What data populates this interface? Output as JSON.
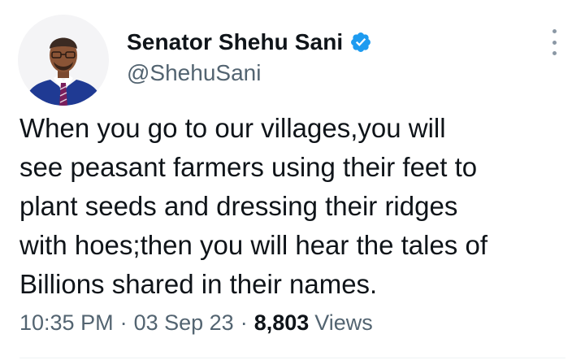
{
  "author": {
    "display_name": "Senator Shehu Sani",
    "handle": "@ShehuSani",
    "verified": true,
    "verified_color": "#1d9bf0"
  },
  "tweet": {
    "lines": [
      "When you go to our villages,you will",
      "see peasant farmers using their feet to",
      "plant seeds and dressing their ridges",
      "with hoes;then you will hear the tales of",
      "Billions shared in their names."
    ],
    "time": "10:35 PM",
    "separator": "·",
    "date": "03 Sep 23",
    "views_count": "8,803",
    "views_label": "Views"
  },
  "icons": {
    "avatar": "profile-photo",
    "verified": "verified-badge-icon",
    "more": "more-options-icon"
  }
}
